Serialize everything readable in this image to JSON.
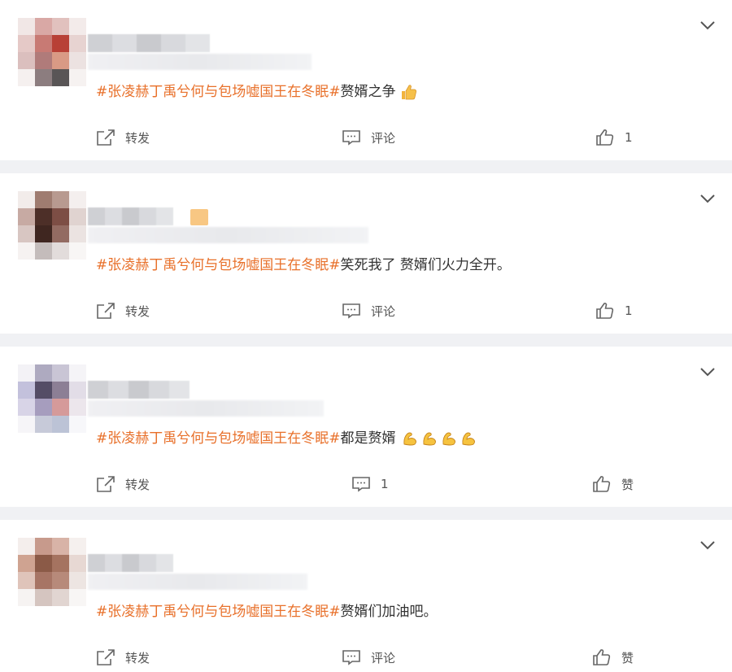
{
  "colors": {
    "topic": "#e8702a",
    "text": "#333333",
    "muted": "#555555",
    "background": "#f0f1f4",
    "card": "#ffffff"
  },
  "posts": [
    {
      "topic": "#张凌赫丁禹兮何与包场嘘国王在冬眠#",
      "text": "赘婿之争",
      "emoji": "thumbs-up",
      "emoji_count": 1,
      "repost_label": "转发",
      "comment_label": "评论",
      "like_label": "1",
      "icons": {
        "repost": "share-icon",
        "comment": "comment-icon",
        "like": "like-icon",
        "menu": "chevron-down-icon"
      }
    },
    {
      "topic": "#张凌赫丁禹兮何与包场嘘国王在冬眠#",
      "text": "笑死我了 赘婿们火力全开。",
      "emoji": "",
      "emoji_count": 0,
      "repost_label": "转发",
      "comment_label": "评论",
      "like_label": "1",
      "icons": {
        "repost": "share-icon",
        "comment": "comment-icon",
        "like": "like-icon",
        "menu": "chevron-down-icon"
      }
    },
    {
      "topic": "#张凌赫丁禹兮何与包场嘘国王在冬眠#",
      "text": "都是赘婿",
      "emoji": "flexed-biceps",
      "emoji_count": 4,
      "repost_label": "转发",
      "comment_label": "1",
      "like_label": "赞",
      "icons": {
        "repost": "share-icon",
        "comment": "comment-icon",
        "like": "like-icon",
        "menu": "chevron-down-icon"
      }
    },
    {
      "topic": "#张凌赫丁禹兮何与包场嘘国王在冬眠#",
      "text": "赘婿们加油吧。",
      "emoji": "",
      "emoji_count": 0,
      "repost_label": "转发",
      "comment_label": "评论",
      "like_label": "赞",
      "icons": {
        "repost": "share-icon",
        "comment": "comment-icon",
        "like": "like-icon",
        "menu": "chevron-down-icon"
      }
    }
  ]
}
